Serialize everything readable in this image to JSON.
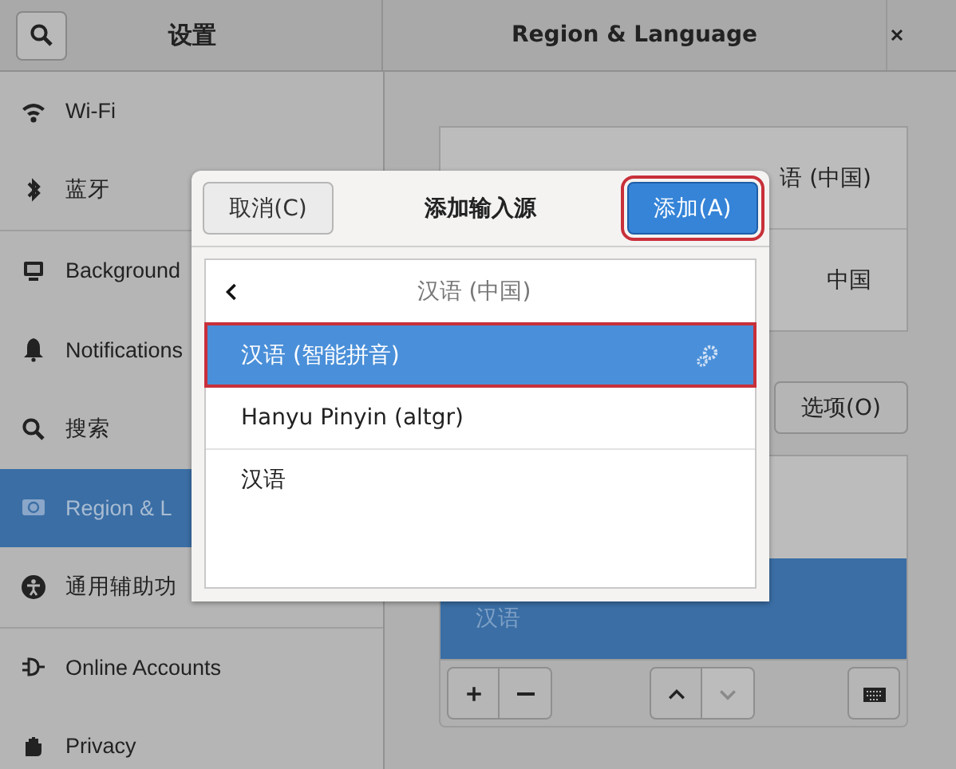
{
  "window": {
    "title": "设置"
  },
  "sidebar": {
    "groups": [
      {
        "items": [
          {
            "label": "Wi-Fi",
            "selected": false
          },
          {
            "label": "蓝牙",
            "selected": false
          }
        ]
      },
      {
        "items": [
          {
            "label": "Background",
            "selected": false
          },
          {
            "label": "Notifications",
            "selected": false
          },
          {
            "label": "搜索",
            "selected": false
          },
          {
            "label": "Region & L",
            "selected": true
          },
          {
            "label": "通用辅助功",
            "selected": false
          }
        ]
      },
      {
        "items": [
          {
            "label": "Online Accounts",
            "selected": false
          },
          {
            "label": "Privacy",
            "selected": false
          }
        ]
      }
    ]
  },
  "panel": {
    "title": "Region & Language",
    "rows": [
      {
        "value": "语 (中国)"
      },
      {
        "value": "中国"
      }
    ],
    "options_button": "选项(O)",
    "input_sources": [
      {
        "label": "汉语",
        "selected": true
      }
    ],
    "toolbar": [
      {
        "kind": "add",
        "disabled": false
      },
      {
        "kind": "remove",
        "disabled": false
      },
      {
        "kind": "up",
        "disabled": false
      },
      {
        "kind": "down",
        "disabled": true
      },
      {
        "kind": "keyboard",
        "disabled": false
      }
    ]
  },
  "dialog": {
    "title": "添加输入源",
    "cancel_button": "取消(C)",
    "add_button": {
      "label": "添加(A)",
      "annotated": true
    },
    "header": "汉语 (中国)",
    "items": [
      {
        "label": "汉语 (智能拼音)",
        "selected": true,
        "has_settings": true,
        "annotated": true
      },
      {
        "label": "Hanyu Pinyin (altgr)",
        "selected": false,
        "has_settings": false,
        "annotated": false
      },
      {
        "label": "汉语",
        "selected": false,
        "has_settings": false,
        "annotated": false
      }
    ]
  }
}
